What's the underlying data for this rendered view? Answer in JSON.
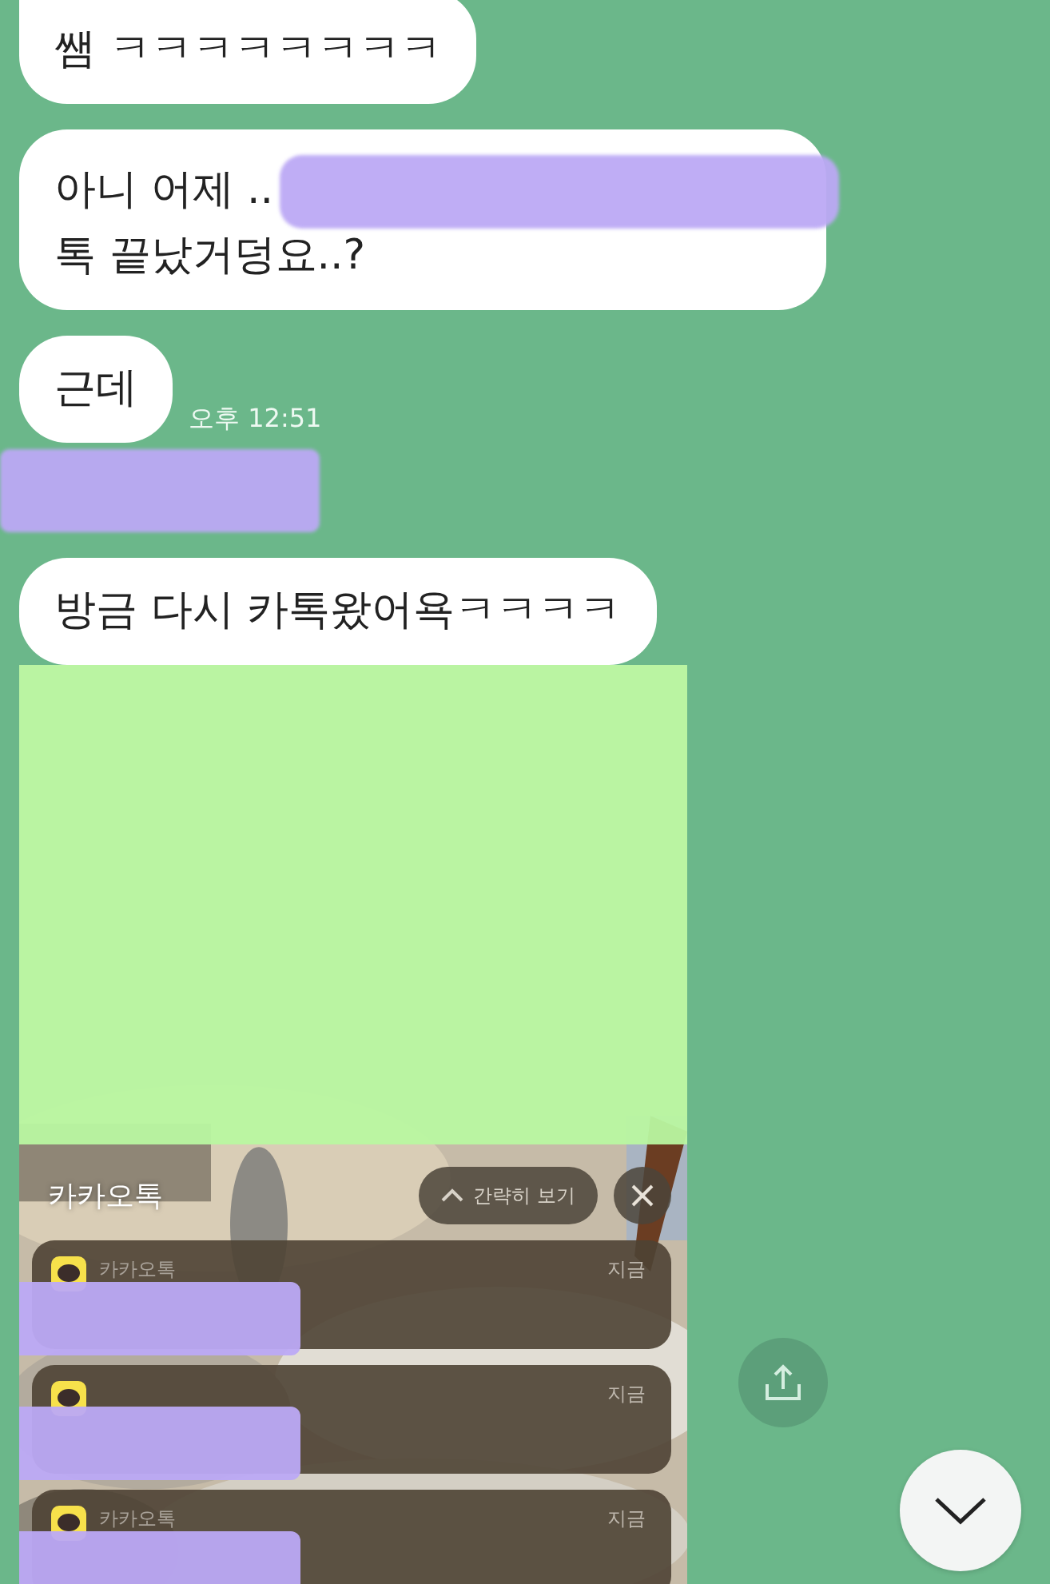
{
  "messages": [
    {
      "kind": "text",
      "lines": [
        {
          "text": "쌤 ㅋㅋㅋㅋㅋㅋㅋㅋ",
          "redacted": false
        }
      ]
    },
    {
      "kind": "text",
      "lines": [
        {
          "text": "아니 어제 ..",
          "redacted": true
        },
        {
          "text": "톡 끝났거덩요..?",
          "redacted": false
        }
      ]
    },
    {
      "kind": "text",
      "lines": [
        {
          "text": "근데",
          "redacted": false
        }
      ],
      "time": "오후 12:51"
    },
    {
      "kind": "redaction"
    },
    {
      "kind": "text",
      "lines": [
        {
          "text": "방금 다시 카톡왔어욕ㅋㅋㅋㅋ",
          "redacted": false
        }
      ]
    },
    {
      "kind": "screenshot",
      "title": "카카오톡",
      "collapse_button": "간략히 보기",
      "notifications": [
        {
          "app": "카카오톡",
          "time": "지금"
        },
        {
          "time": "지금"
        },
        {
          "app": "카카오톡",
          "time": "지금"
        }
      ]
    }
  ]
}
